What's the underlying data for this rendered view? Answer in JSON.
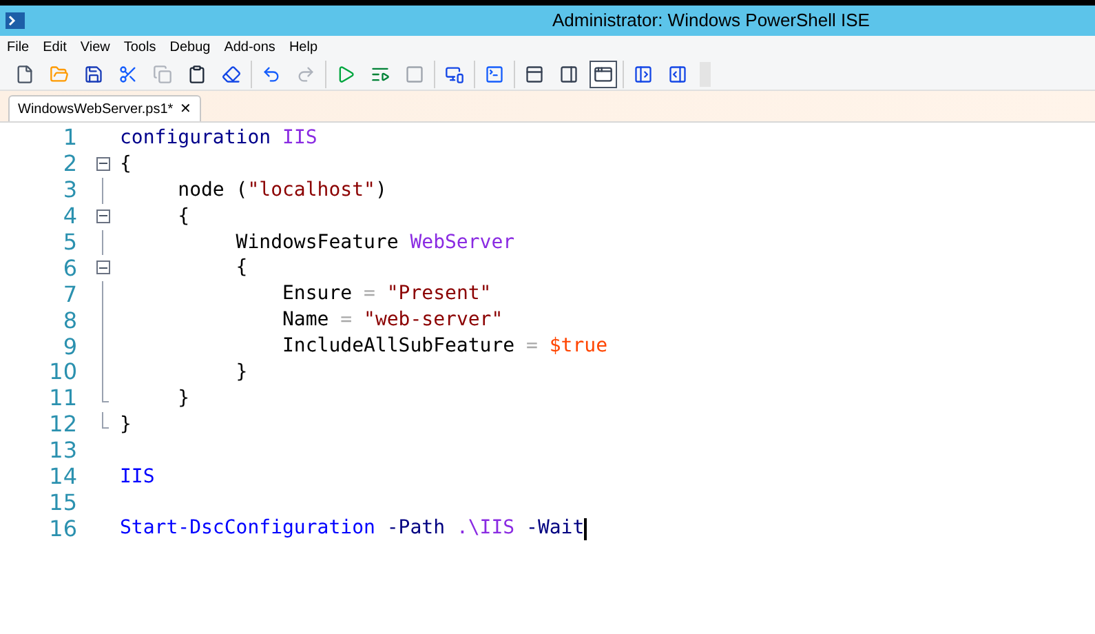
{
  "window": {
    "title": "Administrator: Windows PowerShell ISE"
  },
  "menu": [
    "File",
    "Edit",
    "View",
    "Tools",
    "Debug",
    "Add-ons",
    "Help"
  ],
  "toolbar": [
    [
      {
        "kind": "new",
        "disabled": false
      },
      {
        "kind": "open",
        "disabled": false
      },
      {
        "kind": "save",
        "disabled": false
      },
      {
        "kind": "cut",
        "disabled": false
      },
      {
        "kind": "copy",
        "disabled": true
      },
      {
        "kind": "paste",
        "disabled": false
      },
      {
        "kind": "clear",
        "disabled": false
      }
    ],
    [
      {
        "kind": "undo",
        "disabled": false
      },
      {
        "kind": "redo",
        "disabled": true
      }
    ],
    [
      {
        "kind": "run",
        "disabled": false
      },
      {
        "kind": "runselection",
        "disabled": false
      },
      {
        "kind": "stop",
        "disabled": true
      }
    ],
    [
      {
        "kind": "remote",
        "disabled": false
      }
    ],
    [
      {
        "kind": "console",
        "disabled": false
      }
    ],
    [
      {
        "kind": "layouttop",
        "disabled": false,
        "selected": false
      },
      {
        "kind": "layoutright",
        "disabled": false,
        "selected": false
      },
      {
        "kind": "layoutmax",
        "disabled": false,
        "selected": true
      }
    ],
    [
      {
        "kind": "scriptpane",
        "disabled": false
      },
      {
        "kind": "addon",
        "disabled": false
      }
    ]
  ],
  "tabs": [
    {
      "label": "WindowsWebServer.ps1*",
      "close": "✕",
      "selected": true
    }
  ],
  "editor": {
    "lines": [
      {
        "number": "1",
        "tokens": [
          {
            "kind": "keyword",
            "text": "configuration "
          },
          {
            "kind": "name",
            "text": "IIS"
          }
        ]
      },
      {
        "number": "2",
        "expanded": true,
        "tokens": [
          {
            "kind": "plain",
            "text": "{"
          }
        ]
      },
      {
        "number": "3",
        "guide": true,
        "tokens": [
          {
            "kind": "plain",
            "text": "     node ("
          },
          {
            "kind": "string",
            "text": "\"localhost\""
          },
          {
            "kind": "plain",
            "text": ")"
          }
        ]
      },
      {
        "number": "4",
        "expanded": true,
        "tokens": [
          {
            "kind": "plain",
            "text": "     {"
          }
        ]
      },
      {
        "number": "5",
        "guide": true,
        "tokens": [
          {
            "kind": "plain",
            "text": "          WindowsFeature "
          },
          {
            "kind": "name",
            "text": "WebServer"
          }
        ]
      },
      {
        "number": "6",
        "expanded": true,
        "tokens": [
          {
            "kind": "plain",
            "text": "          {"
          }
        ]
      },
      {
        "number": "7",
        "guide": true,
        "tokens": [
          {
            "kind": "plain",
            "text": "              Ensure "
          },
          {
            "kind": "operator",
            "text": "="
          },
          {
            "kind": "string",
            "text": " \"Present\""
          }
        ]
      },
      {
        "number": "8",
        "guide": true,
        "tokens": [
          {
            "kind": "plain",
            "text": "              Name "
          },
          {
            "kind": "operator",
            "text": "="
          },
          {
            "kind": "string",
            "text": " \"web-server\""
          }
        ]
      },
      {
        "number": "9",
        "guide": true,
        "tokens": [
          {
            "kind": "plain",
            "text": "              IncludeAllSubFeature "
          },
          {
            "kind": "operator",
            "text": "="
          },
          {
            "kind": "variable",
            "text": " $true"
          }
        ]
      },
      {
        "number": "10",
        "guide": true,
        "tokens": [
          {
            "kind": "plain",
            "text": "          }"
          }
        ]
      },
      {
        "number": "11",
        "guide_end": true,
        "tokens": [
          {
            "kind": "plain",
            "text": "     }"
          }
        ]
      },
      {
        "number": "12",
        "guide_end": true,
        "tokens": [
          {
            "kind": "plain",
            "text": "}"
          }
        ]
      },
      {
        "number": "13"
      },
      {
        "number": "14",
        "tokens": [
          {
            "kind": "command",
            "text": "IIS"
          }
        ]
      },
      {
        "number": "15"
      },
      {
        "number": "16",
        "cursor": true,
        "tokens": [
          {
            "kind": "command",
            "text": "Start-DscConfiguration"
          },
          {
            "kind": "parameter",
            "text": " -Path"
          },
          {
            "kind": "name",
            "text": " .\\IIS"
          },
          {
            "kind": "parameter",
            "text": " -Wait"
          }
        ]
      }
    ]
  }
}
